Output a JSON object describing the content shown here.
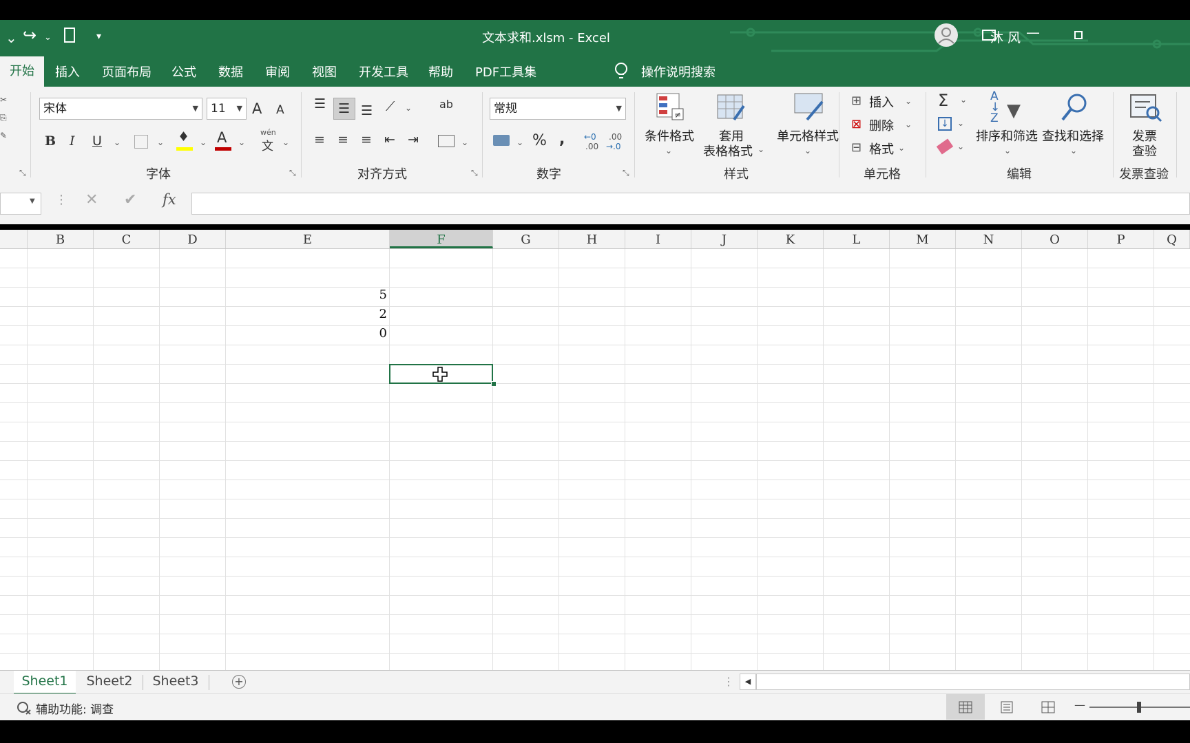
{
  "window": {
    "title": "文本求和.xlsm  -  Excel",
    "user_name": "沐 风"
  },
  "tabs": [
    "开始",
    "插入",
    "页面布局",
    "公式",
    "数据",
    "审阅",
    "视图",
    "开发工具",
    "帮助",
    "PDF工具集"
  ],
  "tell_me": "操作说明搜索",
  "ribbon": {
    "font": {
      "name": "宋体",
      "size": "11",
      "group_label": "字体",
      "bold": "B",
      "italic": "I",
      "underline": "U",
      "grow": "A",
      "shrink": "A",
      "phonetic_top": "wén",
      "phonetic_bottom": "文"
    },
    "alignment": {
      "group_label": "对齐方式",
      "wrap": "ab"
    },
    "number": {
      "format": "常规",
      "group_label": "数字",
      "percent": "%",
      "comma": ",",
      "inc_decimal_top": "←0",
      "inc_decimal_bottom": ".00",
      "dec_decimal_top": ".00",
      "dec_decimal_bottom": "→.0"
    },
    "styles": {
      "group_label": "样式",
      "conditional": "条件格式",
      "table_line1": "套用",
      "table_line2": "表格格式",
      "cell_styles": "单元格样式"
    },
    "cells": {
      "group_label": "单元格",
      "insert": "插入",
      "delete": "删除",
      "format": "格式"
    },
    "editing": {
      "group_label": "编辑",
      "sort_filter": "排序和筛选",
      "find_select": "查找和选择",
      "sort_az": "A↓Z"
    },
    "invoice": {
      "group_label": "发票查验",
      "line1": "发票",
      "line2": "查验"
    }
  },
  "formula_bar": {
    "fx": "fx",
    "value": ""
  },
  "sheet": {
    "columns": [
      "B",
      "C",
      "D",
      "E",
      "F",
      "G",
      "H",
      "I",
      "J",
      "K",
      "L",
      "M",
      "N",
      "O",
      "P",
      "Q"
    ],
    "selected_column": "F",
    "cells": [
      "5",
      "2",
      "0"
    ]
  },
  "sheet_tabs": [
    "Sheet1",
    "Sheet2",
    "Sheet3"
  ],
  "active_sheet": "Sheet1",
  "status": {
    "accessibility": "辅助功能: 调查"
  },
  "colors": {
    "accent": "#217346",
    "ribbon_bg": "#f3f3f3"
  }
}
